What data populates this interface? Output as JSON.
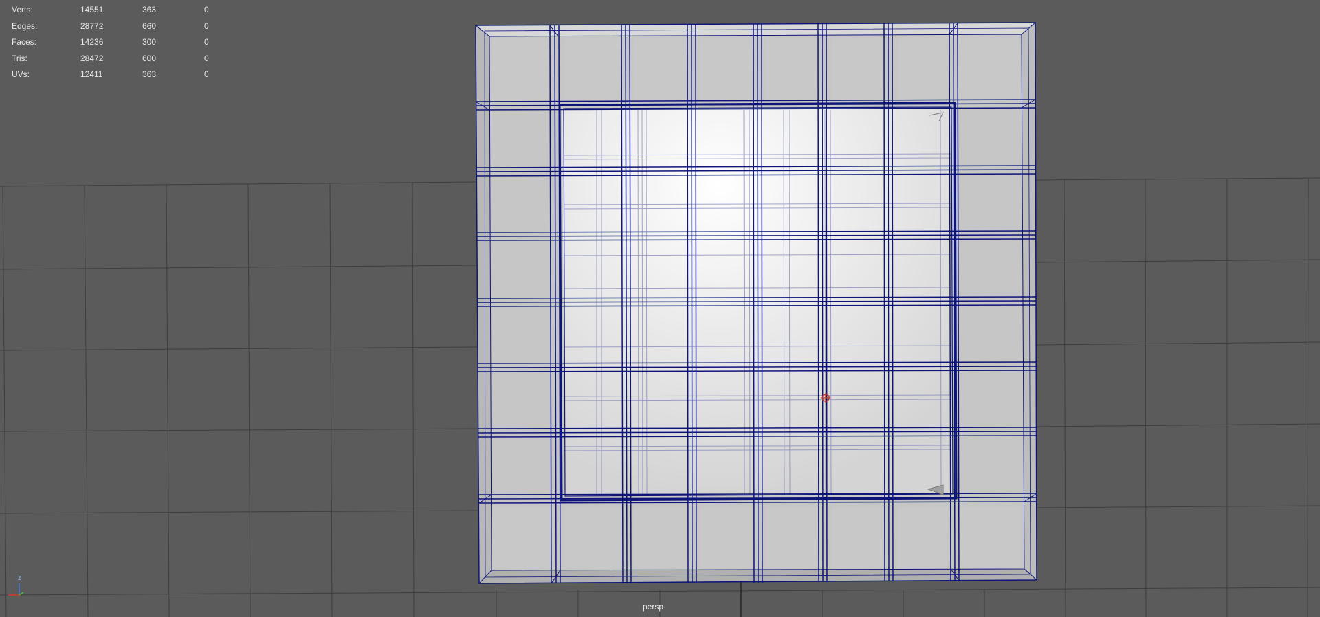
{
  "hud": {
    "rows": [
      {
        "label": "Verts:",
        "total": "14551",
        "selected": "363",
        "third": "0"
      },
      {
        "label": "Edges:",
        "total": "28772",
        "selected": "660",
        "third": "0"
      },
      {
        "label": "Faces:",
        "total": "14236",
        "selected": "300",
        "third": "0"
      },
      {
        "label": "Tris:",
        "total": "28472",
        "selected": "600",
        "third": "0"
      },
      {
        "label": "UVs:",
        "total": "12411",
        "selected": "363",
        "third": "0"
      }
    ]
  },
  "viewport": {
    "camera_label": "persp",
    "axis_label": "z",
    "background_color": "#5b5b5b",
    "grid_color": "#3c3c3c",
    "wire_color": "#0a1270",
    "mesh_face_color": "#c9c9c9",
    "mesh_inner_color": "#ffffff",
    "pivot_color": "#c0392b"
  }
}
